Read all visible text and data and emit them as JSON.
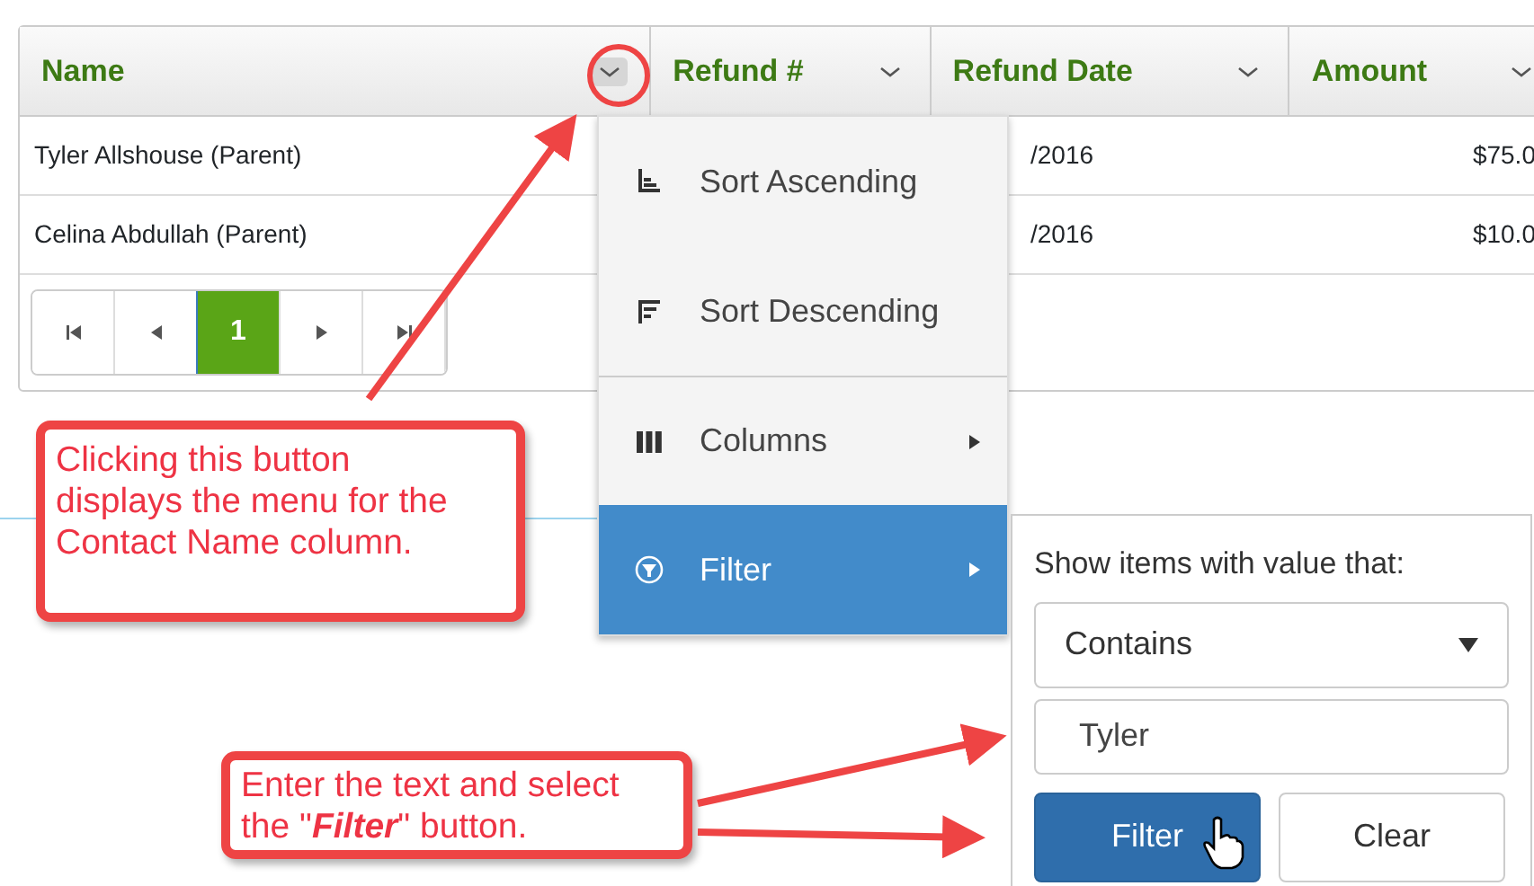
{
  "grid": {
    "columns": [
      {
        "label": "Name",
        "menu_open": true
      },
      {
        "label": "Refund #",
        "menu_open": false
      },
      {
        "label": "Refund Date",
        "menu_open": false
      },
      {
        "label": "Amount",
        "menu_open": false
      }
    ],
    "rows": [
      {
        "name": "Tyler Allshouse (Parent)",
        "refund_date": "/2016",
        "amount": "$75.0"
      },
      {
        "name": "Celina Abdullah (Parent)",
        "refund_date": "/2016",
        "amount": "$10.0"
      }
    ],
    "pager": [
      {
        "kind": "first",
        "selected": false
      },
      {
        "kind": "prev",
        "selected": false
      },
      {
        "kind": "page",
        "label": "1",
        "selected": true
      },
      {
        "kind": "next",
        "selected": false
      },
      {
        "kind": "last",
        "selected": false
      }
    ]
  },
  "column_menu": {
    "items": [
      {
        "kind": "sort-asc",
        "label": "Sort Ascending",
        "selected": false,
        "submenu": false
      },
      {
        "kind": "sort-desc",
        "label": "Sort Descending",
        "selected": false,
        "submenu": false
      },
      {
        "kind": "columns",
        "label": "Columns",
        "selected": false,
        "submenu": true
      },
      {
        "kind": "filter",
        "label": "Filter",
        "selected": true,
        "submenu": true
      }
    ]
  },
  "filter_panel": {
    "label": "Show items with value that:",
    "operator": "Contains",
    "value": "Tyler",
    "buttons": [
      {
        "label": "Filter",
        "primary": true
      },
      {
        "label": "Clear",
        "primary": false
      }
    ]
  },
  "callouts": [
    {
      "text": "Clicking this button displays the menu for the Contact Name column."
    },
    {
      "text": "Enter the text and select the \"**Filter**\" button."
    }
  ]
}
